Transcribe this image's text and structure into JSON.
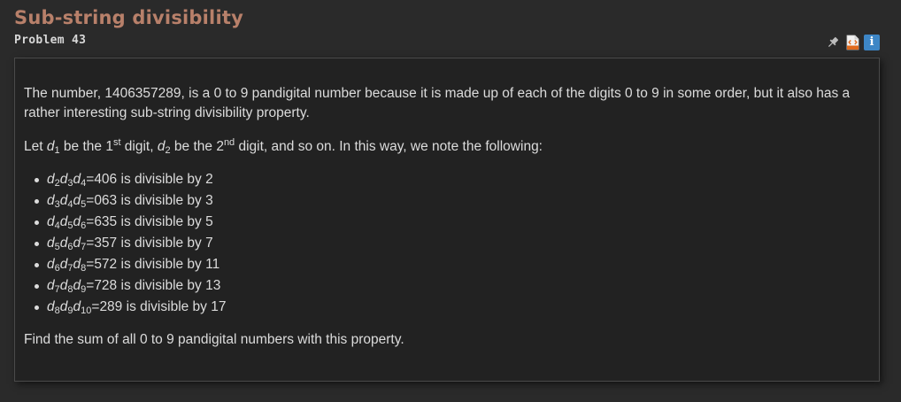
{
  "title": "Sub-string divisibility",
  "problem_label": "Problem 43",
  "icons": [
    "pin-icon",
    "html-file-icon",
    "info-icon"
  ],
  "info_label": "i",
  "paragraph1": "The number, 1406357289, is a 0 to 9 pandigital number because it is made up of each of the digits 0 to 9 in some order, but it also has a rather interesting sub-string divisibility property.",
  "paragraph2": {
    "text1": "Let ",
    "d1_var": "d",
    "d1_sub": "1",
    "text2": " be the 1",
    "sup1": "st",
    "text3": " digit, ",
    "d2_var": "d",
    "d2_sub": "2",
    "text4": " be the 2",
    "sup2": "nd",
    "text5": " digit, and so on. In this way, we note the following:"
  },
  "properties": [
    {
      "subs": [
        "2",
        "3",
        "4"
      ],
      "value": "406",
      "divisor": "2"
    },
    {
      "subs": [
        "3",
        "4",
        "5"
      ],
      "value": "063",
      "divisor": "3"
    },
    {
      "subs": [
        "4",
        "5",
        "6"
      ],
      "value": "635",
      "divisor": "5"
    },
    {
      "subs": [
        "5",
        "6",
        "7"
      ],
      "value": "357",
      "divisor": "7"
    },
    {
      "subs": [
        "6",
        "7",
        "8"
      ],
      "value": "572",
      "divisor": "11"
    },
    {
      "subs": [
        "7",
        "8",
        "9"
      ],
      "value": "728",
      "divisor": "13"
    },
    {
      "subs": [
        "8",
        "9",
        "10"
      ],
      "value": "289",
      "divisor": "17"
    }
  ],
  "divisible_text": " is divisible by ",
  "paragraph3": "Find the sum of all 0 to 9 pandigital numbers with this property."
}
